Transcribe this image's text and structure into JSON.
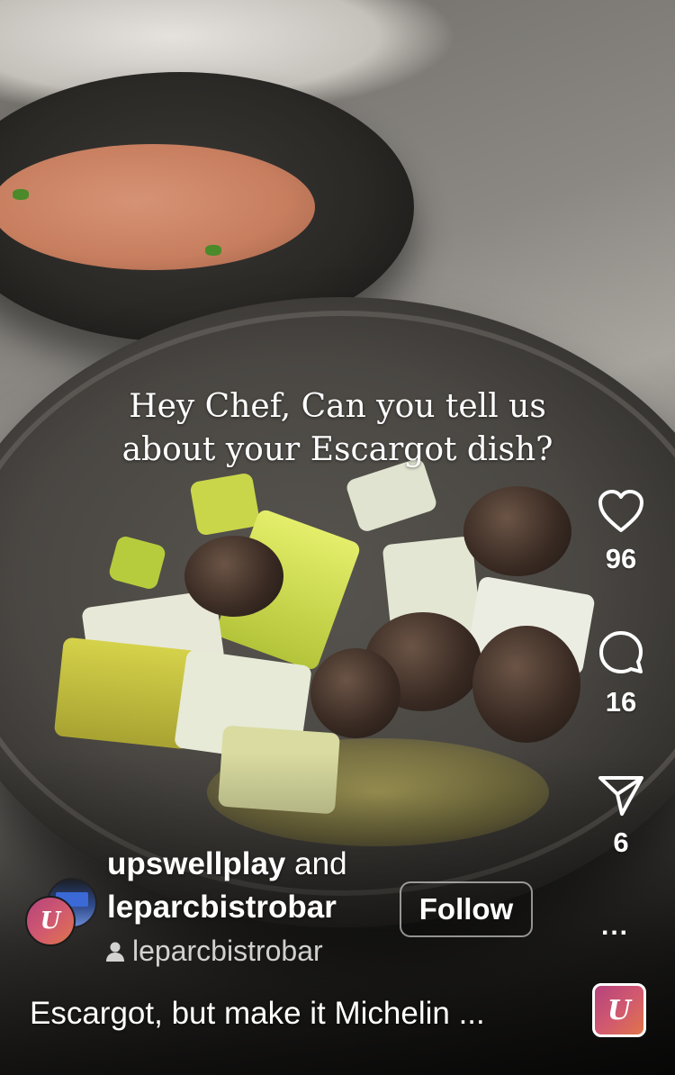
{
  "overlay_text": {
    "line1": "Hey Chef, Can you tell us",
    "line2": "about your Escargot dish?"
  },
  "actions": {
    "like": {
      "icon": "heart-icon",
      "count": "96"
    },
    "comment": {
      "icon": "comment-bubble-icon",
      "count": "16"
    },
    "share": {
      "icon": "paper-plane-icon",
      "count": "6"
    },
    "more": {
      "icon": "more-dots-icon",
      "label": "..."
    }
  },
  "author": {
    "user1": "upswellplay",
    "connector": "and",
    "user2": "leparcbistrobar",
    "follow_label": "Follow",
    "sub_user": "leparcbistrobar",
    "avatar_letter": "U"
  },
  "caption": "Escargot, but make it Michelin ...",
  "audio": {
    "letter": "U"
  }
}
